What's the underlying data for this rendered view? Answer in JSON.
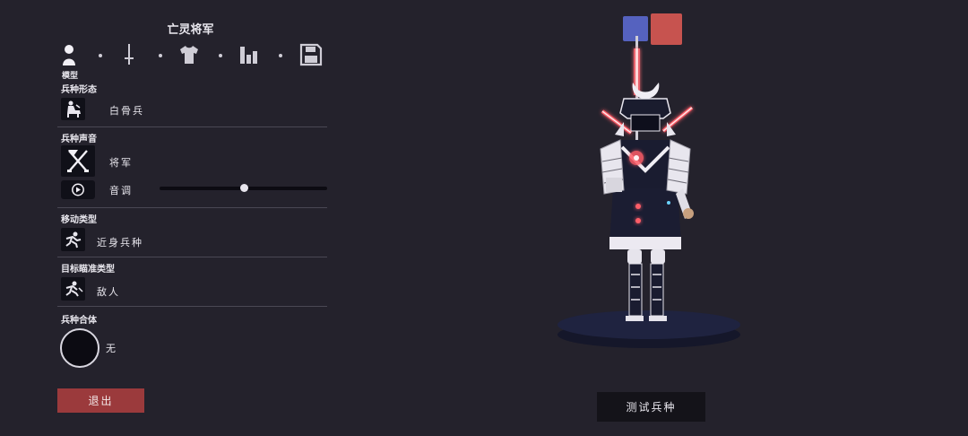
{
  "unit": {
    "name": "亡灵将军"
  },
  "tabs": {
    "items": [
      {
        "icon": "person-icon"
      },
      {
        "icon": "sword-icon"
      },
      {
        "icon": "shirt-icon"
      },
      {
        "icon": "stats-bars-icon"
      },
      {
        "icon": "save-icon"
      }
    ],
    "active_label": "模型"
  },
  "sections": {
    "form": {
      "title": "兵种形态",
      "value": "白骨兵",
      "icon": "skeleton-rider-icon"
    },
    "voice": {
      "title": "兵种声音",
      "value": "将军",
      "icon": "crossed-swords-icon",
      "pitch_label": "音调",
      "pitch_icon": "play-icon",
      "pitch_level": 0.5
    },
    "movement": {
      "title": "移动类型",
      "value": "近身兵种",
      "icon": "running-figure-icon"
    },
    "targeting": {
      "title": "目标瞄准类型",
      "value": "敌人",
      "icon": "target-figure-icon"
    },
    "combine": {
      "title": "兵种合体",
      "value": "无"
    }
  },
  "buttons": {
    "exit": "退出",
    "test": "测试兵种"
  },
  "team_colors": {
    "blue": "#5562bf",
    "red": "#c7534f"
  },
  "colors": {
    "background": "#24222c",
    "exit_button": "#9b3a3c",
    "glow": "#ff3b47"
  }
}
